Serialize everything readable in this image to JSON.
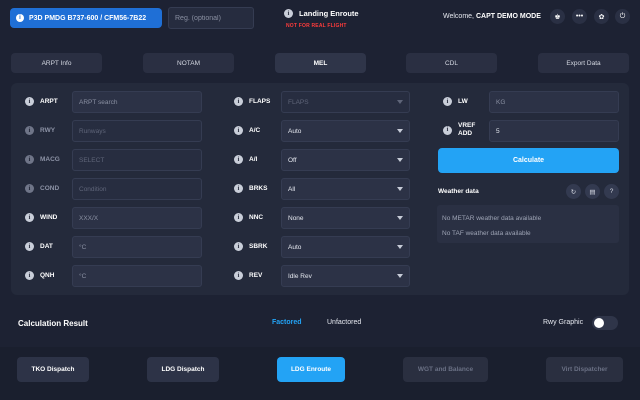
{
  "header": {
    "aircraft": "P3D PMDG B737-600 / CFM56-7B22",
    "reg_placeholder": "Reg. (optional)",
    "mode_title": "Landing Enroute",
    "warning": "NOT FOR REAL FLIGHT",
    "welcome_prefix": "Welcome,",
    "user": "CAPT DEMO MODE",
    "icons": [
      "trophy-icon",
      "more-icon",
      "settings-icon",
      "logout-icon"
    ]
  },
  "tabs": [
    "ARPT Info",
    "NOTAM",
    "MEL",
    "CDL",
    "Export Data"
  ],
  "left_fields": [
    {
      "label": "ARPT",
      "value": "ARPT search",
      "placeholder": true,
      "enabled": true
    },
    {
      "label": "RWY",
      "value": "Runways",
      "placeholder": true,
      "enabled": false
    },
    {
      "label": "MACG",
      "value": "SELECT",
      "placeholder": true,
      "enabled": false
    },
    {
      "label": "COND",
      "value": "Condition",
      "placeholder": true,
      "enabled": false
    },
    {
      "label": "WIND",
      "value": "XXX/X",
      "placeholder": true,
      "enabled": true
    },
    {
      "label": "DAT",
      "value": "°C",
      "placeholder": true,
      "enabled": true
    },
    {
      "label": "QNH",
      "value": "°C",
      "placeholder": true,
      "enabled": true
    }
  ],
  "mid_fields": [
    {
      "label": "FLAPS",
      "value": "FLAPS",
      "enabled": false
    },
    {
      "label": "A/C",
      "value": "Auto",
      "enabled": true
    },
    {
      "label": "A/I",
      "value": "Off",
      "enabled": true
    },
    {
      "label": "BRKS",
      "value": "All",
      "enabled": true
    },
    {
      "label": "NNC",
      "value": "None",
      "enabled": true
    },
    {
      "label": "SBRK",
      "value": "Auto",
      "enabled": true
    },
    {
      "label": "REV",
      "value": "Idle Rev",
      "enabled": true
    }
  ],
  "right_fields": {
    "lw_label": "LW",
    "lw_placeholder": "KG",
    "vref_label_1": "VREF",
    "vref_label_2": "ADD",
    "vref_value": "5"
  },
  "calculate_label": "Calculate",
  "weather": {
    "title": "Weather data",
    "icons": [
      "refresh-icon",
      "printer-icon",
      "help-icon"
    ],
    "metar": "No METAR weather data available",
    "taf": "No TAF weather data available"
  },
  "result": {
    "title": "Calculation Result",
    "factored": "Factored",
    "unfactored": "Unfactored",
    "rwy_graphic": "Rwy Graphic",
    "rwy_graphic_on": false
  },
  "dispatch": [
    "TKO Dispatch",
    "LDG Dispatch",
    "LDG Enroute",
    "WGT and Balance",
    "Virt Dispatcher"
  ],
  "colors": {
    "accent": "#23a3f5",
    "brand": "#1f6fd6",
    "warning": "#ff3b3b",
    "background": "#1d2233"
  }
}
